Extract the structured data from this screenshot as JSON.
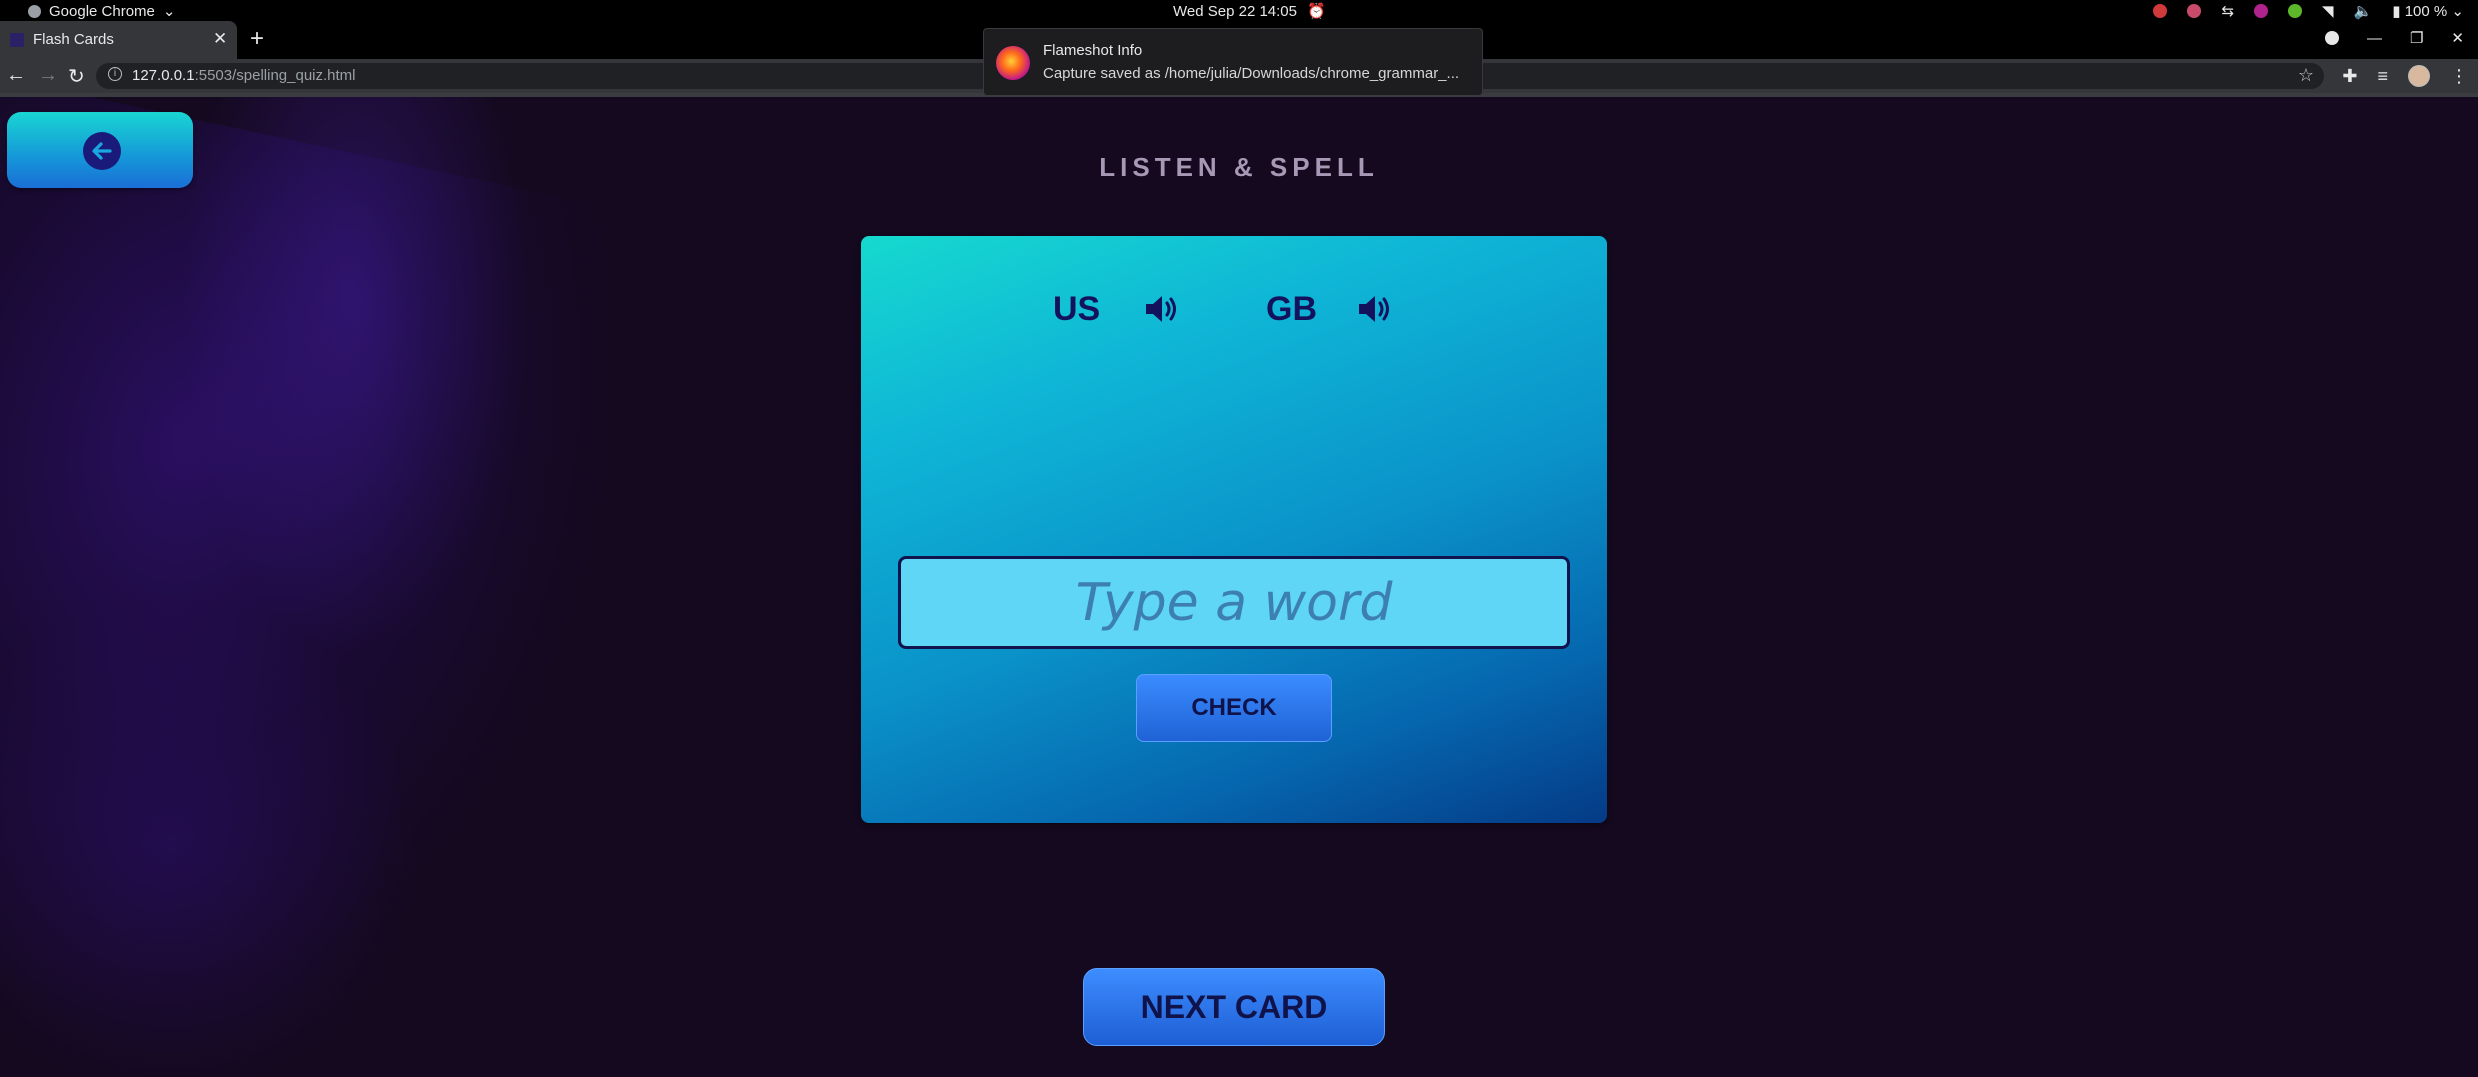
{
  "os": {
    "app_name": "Google Chrome",
    "datetime": "Wed Sep 22  14:05",
    "battery": "100 %"
  },
  "browser": {
    "tab_title": "Flash Cards",
    "url_host": "127.0.0.1",
    "url_path": ":5503/spelling_quiz.html"
  },
  "notification": {
    "title": "Flameshot Info",
    "body": "Capture saved as /home/julia/Downloads/chrome_grammar_..."
  },
  "page": {
    "heading": "LISTEN & SPELL",
    "accents": [
      {
        "label": "US",
        "icon": "speaker-icon"
      },
      {
        "label": "GB",
        "icon": "speaker-icon"
      }
    ],
    "input": {
      "placeholder": "Type a word",
      "value": ""
    },
    "check_label": "CHECK",
    "next_label": "NEXT CARD"
  },
  "colors": {
    "background": "#14091f",
    "accent_text": "#13125c",
    "button_blue": "#1f63d6"
  }
}
